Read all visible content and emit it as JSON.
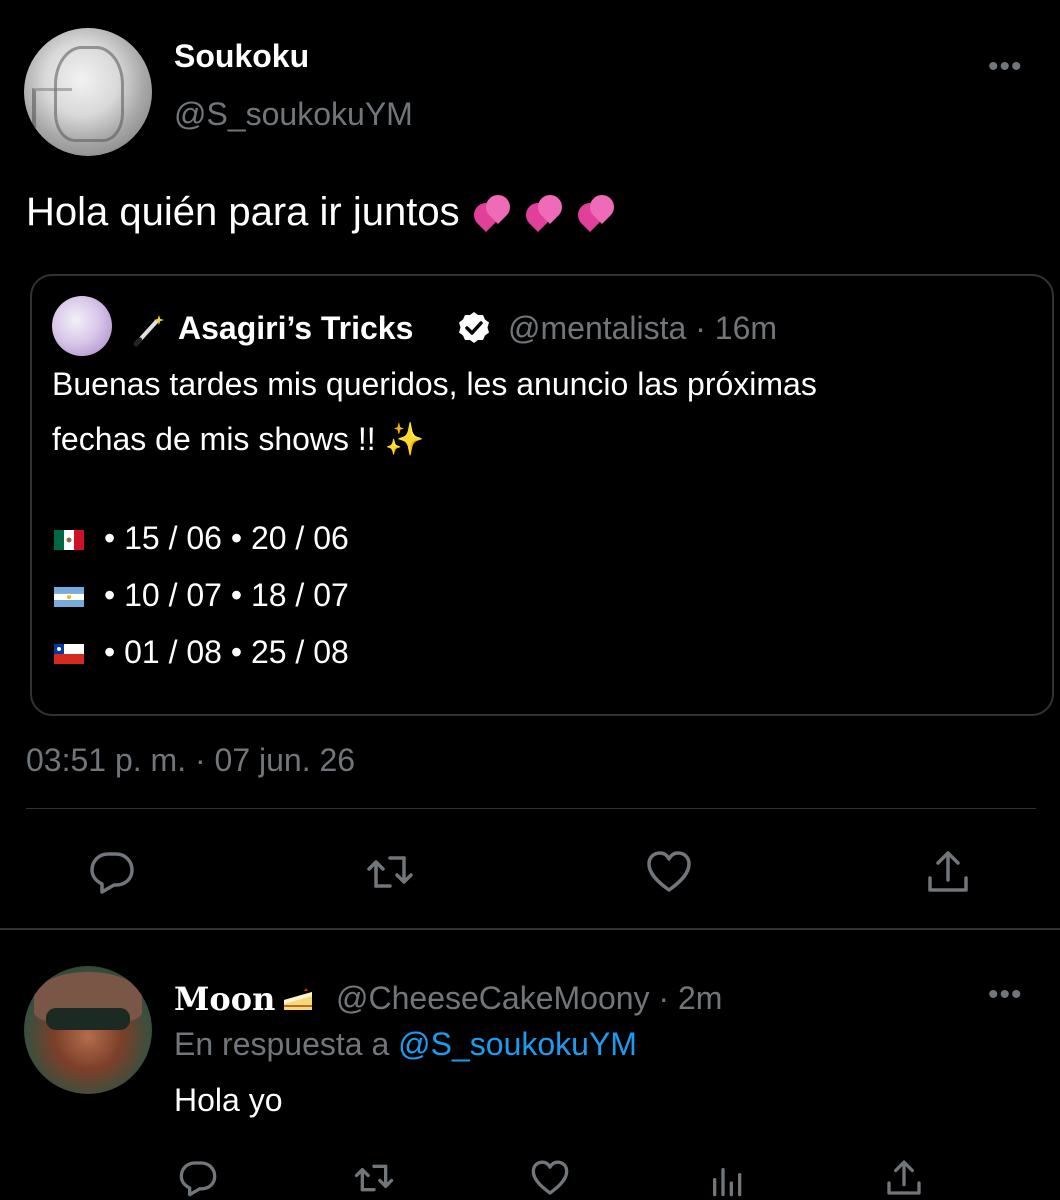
{
  "main_tweet": {
    "author_name": "Soukoku",
    "author_handle": "@S_soukokuYM",
    "text": "Hola quién para ir juntos",
    "emoji": "💞💞💞",
    "timestamp": "03:51 p. m. · 07 jun. 26",
    "more_label": "•••"
  },
  "quoted_tweet": {
    "author_name": "Asagiri’s Tricks",
    "author_prefix_icon": "magic-wand",
    "verified": true,
    "meta": "@mentalista · 16m",
    "line1": "Buenas tardes mis queridos, les anuncio las próximas",
    "line2": "fechas de mis shows !! ✨",
    "dates": [
      {
        "flag": "mexico",
        "text": "• 15 / 06 • 20 / 06"
      },
      {
        "flag": "argentina",
        "text": "• 10 / 07  • 18 / 07"
      },
      {
        "flag": "chile",
        "text": "• 01 / 08 • 25 / 08"
      }
    ]
  },
  "reply": {
    "author_name": "Moon",
    "author_suffix_icon": "cake",
    "meta": "@CheeseCakeMoony · 2m",
    "reply_prefix": "En respuesta a ",
    "reply_mention": "@S_soukokuYM",
    "text": "Hola yo",
    "more_label": "•••"
  },
  "colors": {
    "background": "#000000",
    "text": "#ffffff",
    "muted": "#71767b",
    "border": "#2f3336",
    "link": "#1d9bf0"
  }
}
